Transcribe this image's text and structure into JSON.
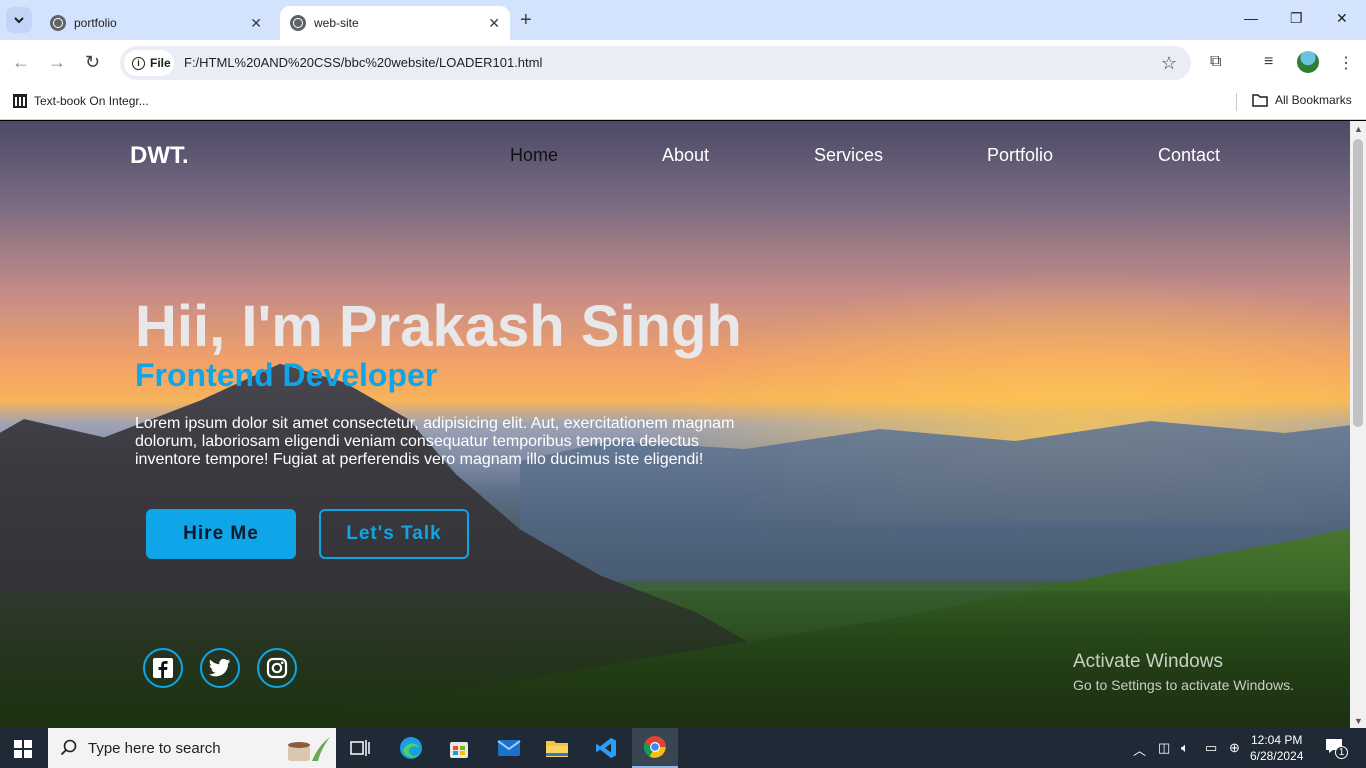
{
  "browser": {
    "tabs": [
      {
        "title": "portfolio",
        "active": false
      },
      {
        "title": "web-site",
        "active": true
      }
    ],
    "url_chip": "File",
    "url": "F:/HTML%20AND%20CSS/bbc%20website/LOADER101.html",
    "bookmarks": [
      {
        "label": "Text-book On Integr..."
      }
    ],
    "all_bookmarks": "All Bookmarks"
  },
  "site": {
    "logo": "DWT.",
    "nav": [
      {
        "label": "Home",
        "active": true
      },
      {
        "label": "About",
        "active": false
      },
      {
        "label": "Services",
        "active": false
      },
      {
        "label": "Portfolio",
        "active": false
      },
      {
        "label": "Contact",
        "active": false
      }
    ],
    "hero": {
      "title": "Hii, I'm Prakash Singh",
      "subtitle": "Frontend Developer",
      "text": "Lorem ipsum dolor sit amet consectetur, adipisicing elit. Aut, exercitationem magnam dolorum, laboriosam eligendi veniam consequatur temporibus tempora delectus inventore tempore! Fugiat at perferendis vero magnam illo ducimus iste eligendi!",
      "primary_button": "Hire Me",
      "secondary_button": "Let's Talk"
    },
    "social": [
      "facebook-icon",
      "twitter-icon",
      "instagram-icon"
    ],
    "accent_color": "#0ea5e9"
  },
  "watermark": {
    "line1": "Activate Windows",
    "line2": "Go to Settings to activate Windows."
  },
  "taskbar": {
    "search_placeholder": "Type here to search",
    "time": "12:04 PM",
    "date": "6/28/2024",
    "notifications": "1"
  }
}
